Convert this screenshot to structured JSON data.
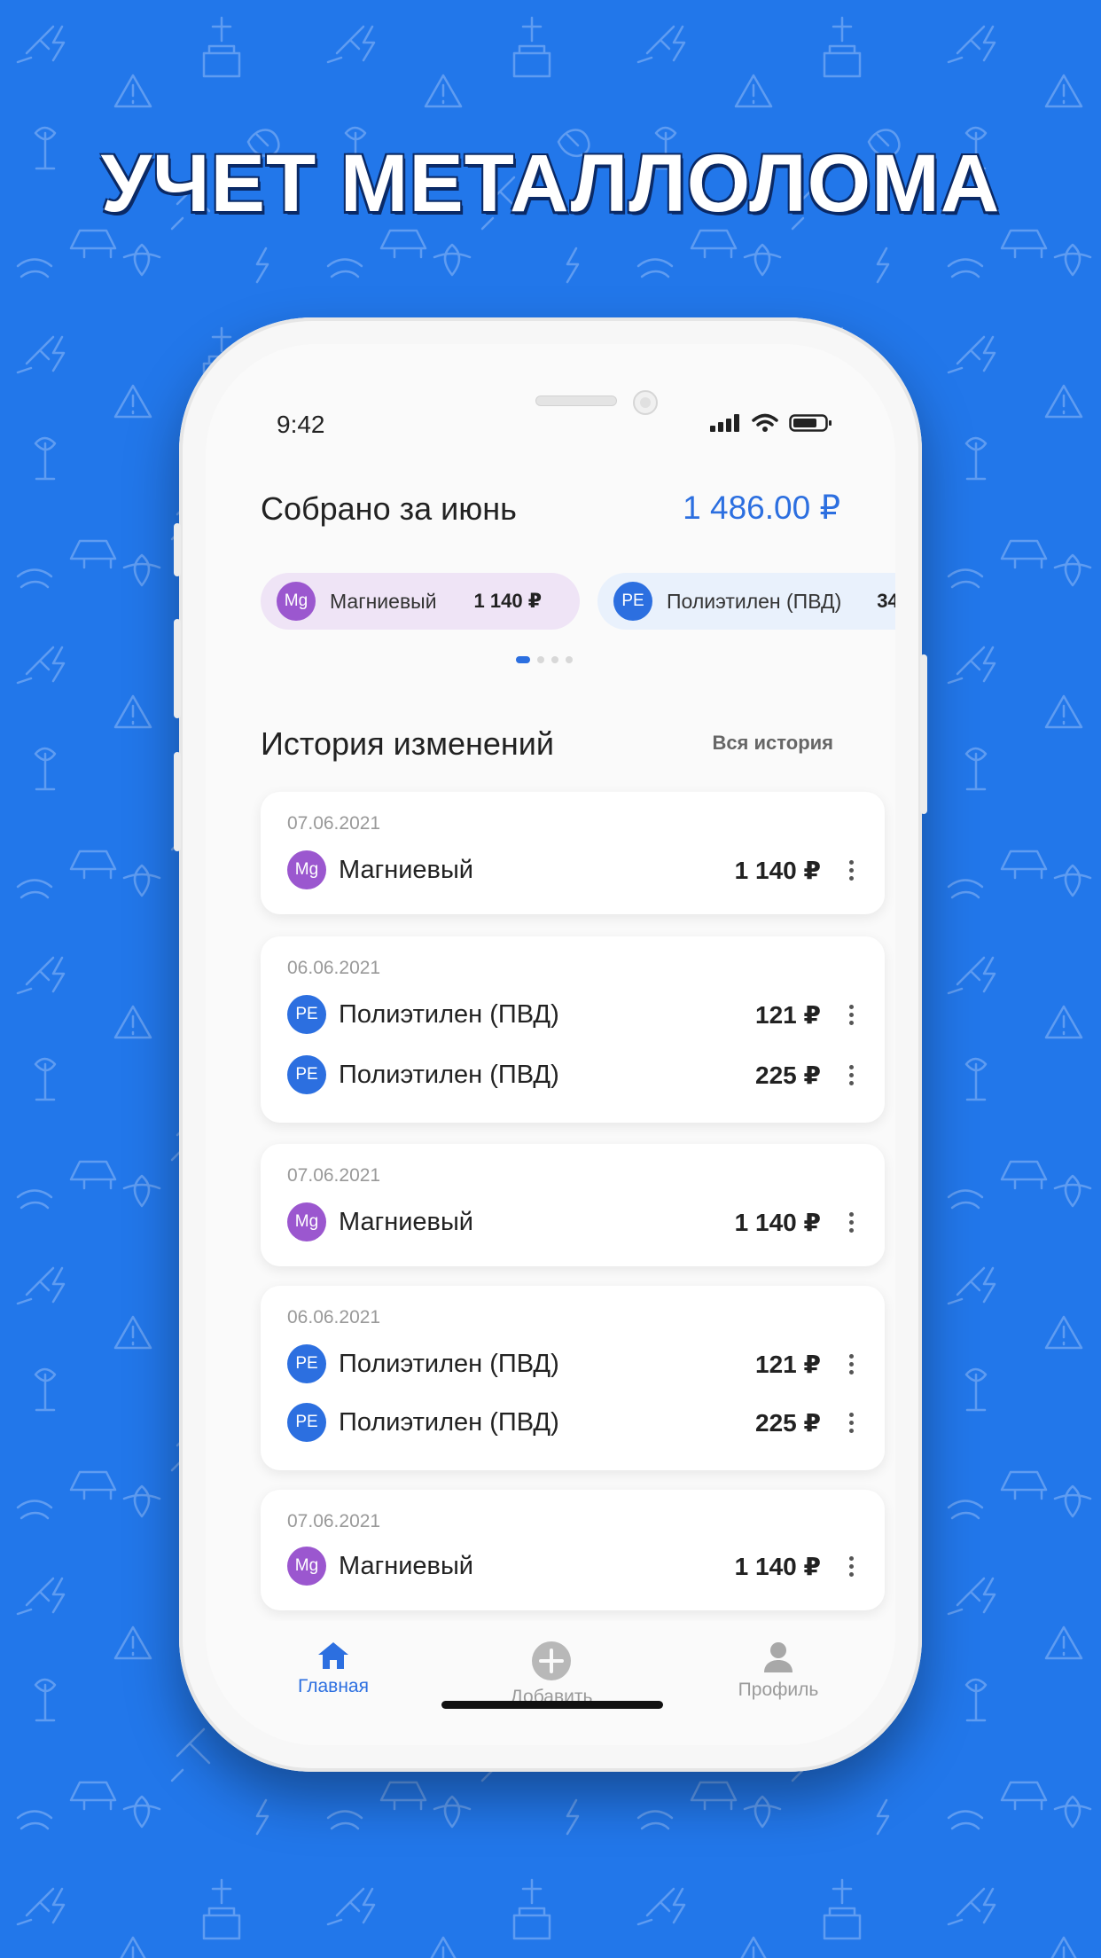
{
  "headline": "УЧЕТ МЕТАЛЛОЛОМА",
  "colors": {
    "background": "#2277ea",
    "accent": "#2c6fe0",
    "mg_badge": "#9b57cf",
    "pe_badge": "#2c6fe0"
  },
  "status_bar": {
    "time": "9:42",
    "icons": [
      "signal-icon",
      "wifi-icon",
      "battery-icon"
    ]
  },
  "header": {
    "title": "Собрано за июнь",
    "total": "1 486.00 ₽"
  },
  "chips": [
    {
      "badge": "Mg",
      "name": "Магниевый",
      "amount": "1 140 ₽"
    },
    {
      "badge": "PE",
      "name": "Полиэтилен (ПВД)",
      "amount": "34"
    }
  ],
  "pager": {
    "count": 4,
    "active": 1
  },
  "history": {
    "title": "История изменений",
    "link": "Вся история",
    "cards": [
      {
        "date": "07.06.2021",
        "rows": [
          {
            "badge": "Mg",
            "name": "Магниевый",
            "amount": "1 140 ₽"
          }
        ]
      },
      {
        "date": "06.06.2021",
        "rows": [
          {
            "badge": "PE",
            "name": "Полиэтилен (ПВД)",
            "amount": "121 ₽"
          },
          {
            "badge": "PE",
            "name": "Полиэтилен (ПВД)",
            "amount": "225 ₽"
          }
        ]
      },
      {
        "date": "07.06.2021",
        "rows": [
          {
            "badge": "Mg",
            "name": "Магниевый",
            "amount": "1 140 ₽"
          }
        ]
      },
      {
        "date": "06.06.2021",
        "rows": [
          {
            "badge": "PE",
            "name": "Полиэтилен (ПВД)",
            "amount": "121 ₽"
          },
          {
            "badge": "PE",
            "name": "Полиэтилен (ПВД)",
            "amount": "225 ₽"
          }
        ]
      },
      {
        "date": "07.06.2021",
        "rows": [
          {
            "badge": "Mg",
            "name": "Магниевый",
            "amount": "1 140 ₽"
          }
        ]
      }
    ]
  },
  "tabbar": {
    "home": {
      "label": "Главная",
      "icon": "home-icon"
    },
    "add": {
      "label": "Добавить",
      "icon": "plus-circle-icon"
    },
    "profile": {
      "label": "Профиль",
      "icon": "user-icon"
    }
  }
}
